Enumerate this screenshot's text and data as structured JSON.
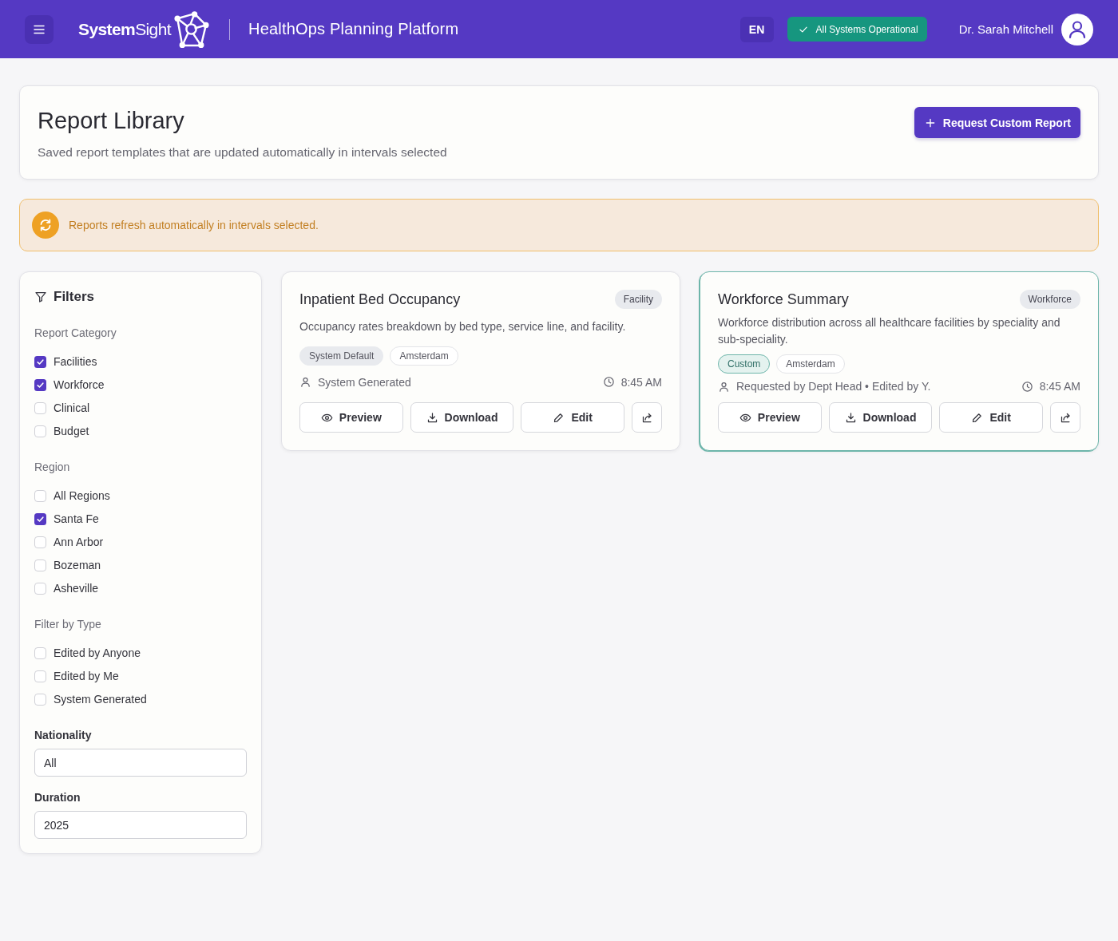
{
  "header": {
    "logo": "**System**Sight",
    "title": "HealthOps Planning Platform",
    "language": "EN",
    "status": "All Systems Operational",
    "user": "Dr. Sarah Mitchell"
  },
  "page_header": {
    "title": "Report Library",
    "subtitle": "Saved report templates that are updated automatically in intervals selected",
    "action": "Request Custom Report"
  },
  "notice": {
    "text": "Reports refresh automatically in intervals selected."
  },
  "filters": {
    "title": "Filters",
    "groups": [
      {
        "label": "Report Category",
        "options": [
          {
            "label": "Facilities",
            "checked": true
          },
          {
            "label": "Workforce",
            "checked": true
          },
          {
            "label": "Clinical",
            "checked": false
          },
          {
            "label": "Budget",
            "checked": false
          }
        ]
      },
      {
        "label": "Region",
        "options": [
          {
            "label": "All Regions",
            "checked": false
          },
          {
            "label": "Santa Fe",
            "checked": true
          },
          {
            "label": "Ann Arbor",
            "checked": false
          },
          {
            "label": "Bozeman",
            "checked": false
          },
          {
            "label": "Asheville",
            "checked": false
          }
        ]
      },
      {
        "label": "Filter by Type",
        "options": [
          {
            "label": "Edited by Anyone",
            "checked": false
          },
          {
            "label": "Edited by Me",
            "checked": false
          },
          {
            "label": "System Generated",
            "checked": false
          }
        ]
      }
    ],
    "fields": [
      {
        "label": "Nationality",
        "value": "All"
      },
      {
        "label": "Duration",
        "value": "2025"
      }
    ]
  },
  "reports": [
    {
      "title": "Inpatient Bed Occupancy",
      "category": "Facility",
      "description": "Occupancy rates breakdown by bed type, service line, and facility.",
      "selected": false,
      "tags": [
        {
          "label": "System Default",
          "kind": "system"
        },
        {
          "label": "Amsterdam",
          "kind": "location"
        }
      ],
      "author": "System Generated",
      "time": "8:45 AM",
      "actions": [
        {
          "kind": "preview",
          "label": "Preview"
        },
        {
          "kind": "download",
          "label": "Download"
        },
        {
          "kind": "edit",
          "label": "Edit"
        },
        {
          "kind": "share"
        }
      ]
    },
    {
      "title": "Workforce Summary",
      "category": "Workforce",
      "description": "Workforce distribution across all healthcare facilities by speciality and sub-speciality.",
      "selected": true,
      "tags": [
        {
          "label": "Custom",
          "kind": "custom"
        },
        {
          "label": "Amsterdam",
          "kind": "location"
        }
      ],
      "author": "Requested by Dept Head • Edited by Y.",
      "time": "8:45 AM",
      "actions": [
        {
          "kind": "preview",
          "label": "Preview"
        },
        {
          "kind": "download",
          "label": "Download"
        },
        {
          "kind": "edit",
          "label": "Edit"
        },
        {
          "kind": "share"
        }
      ]
    }
  ]
}
